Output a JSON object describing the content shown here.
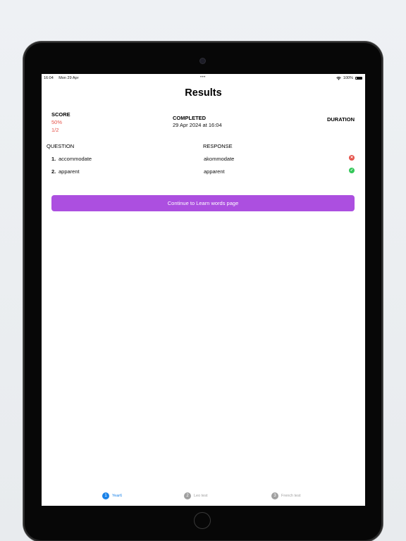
{
  "status_bar": {
    "time": "16:04",
    "date": "Mon 29 Apr",
    "dots": "•••",
    "wifi_icon": "wifi-icon",
    "battery": "100%",
    "battery_icon": "battery-icon"
  },
  "page": {
    "title": "Results"
  },
  "summary": {
    "score_label": "SCORE",
    "score_percent": "50%",
    "score_fraction": "1/2",
    "completed_label": "COMPLETED",
    "completed_value": "29 Apr 2024 at 16:04",
    "duration_label": "DURATION"
  },
  "table": {
    "question_header": "QUESTION",
    "response_header": "RESPONSE",
    "rows": [
      {
        "number": "1.",
        "question": "accommodate",
        "response": "akommodate",
        "correct": false,
        "icon": "x-circle-icon"
      },
      {
        "number": "2.",
        "question": "apparent",
        "response": "apparent",
        "correct": true,
        "icon": "check-circle-icon"
      }
    ]
  },
  "actions": {
    "continue_label": "Continue to Learn words page"
  },
  "tabs": [
    {
      "badge": "1",
      "label": "Year6",
      "active": true
    },
    {
      "badge": "2",
      "label": "Leo test",
      "active": false
    },
    {
      "badge": "3",
      "label": "French test",
      "active": false
    }
  ],
  "colors": {
    "accent_button": "#ac4fe0",
    "score_red": "#e5534b",
    "wrong_icon": "#e5534b",
    "correct_icon": "#34c759",
    "tab_active": "#1a82e8",
    "tab_inactive": "#a0a0a0"
  }
}
